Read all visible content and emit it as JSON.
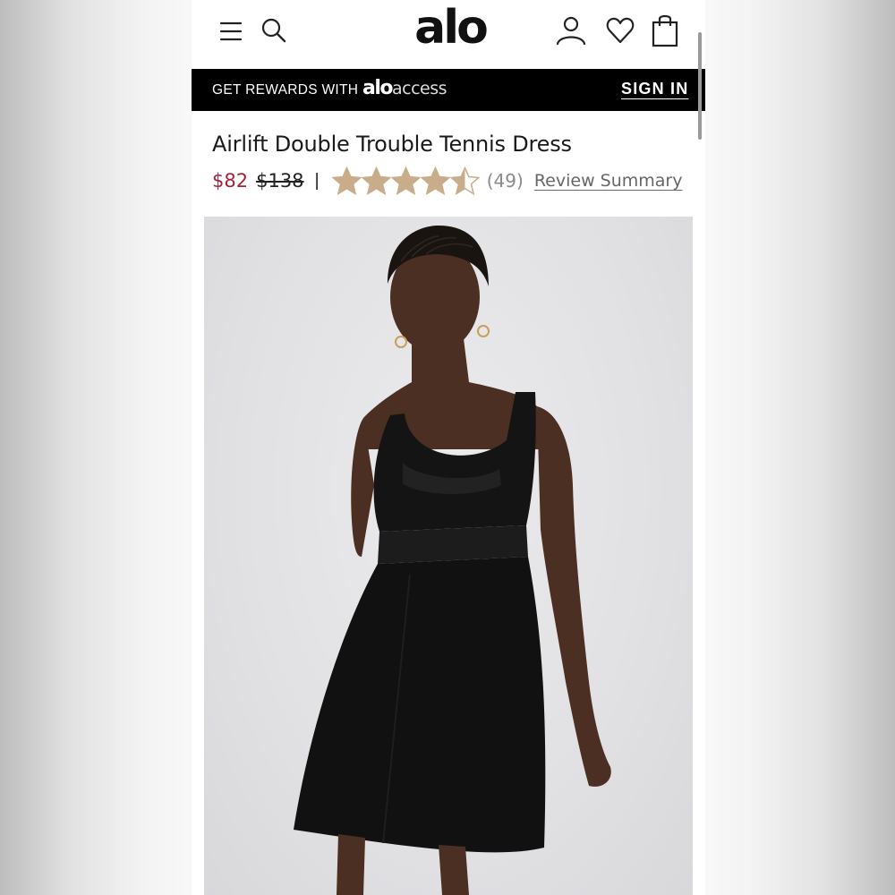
{
  "header": {
    "logo": "alo",
    "menu_icon": "hamburger-menu-icon",
    "search_icon": "search-icon",
    "account_icon": "account-icon",
    "wishlist_icon": "heart-icon",
    "bag_icon": "shopping-bag-icon"
  },
  "banner": {
    "text": "GET REWARDS WITH",
    "brand_bold": "alo",
    "brand_light": "access",
    "sign_in": "SIGN IN"
  },
  "product": {
    "title": "Airlift Double Trouble Tennis Dress",
    "sale_price": "$82",
    "original_price": "$138",
    "separator": "|",
    "rating": 4.5,
    "rating_max": 5,
    "review_count": "(49)",
    "review_summary": "Review Summary",
    "image": "model-in-black-tennis-dress-photo"
  },
  "colors": {
    "sale_price": "#a3213a",
    "star": "#c9ad8a",
    "banner_bg": "#000000"
  }
}
